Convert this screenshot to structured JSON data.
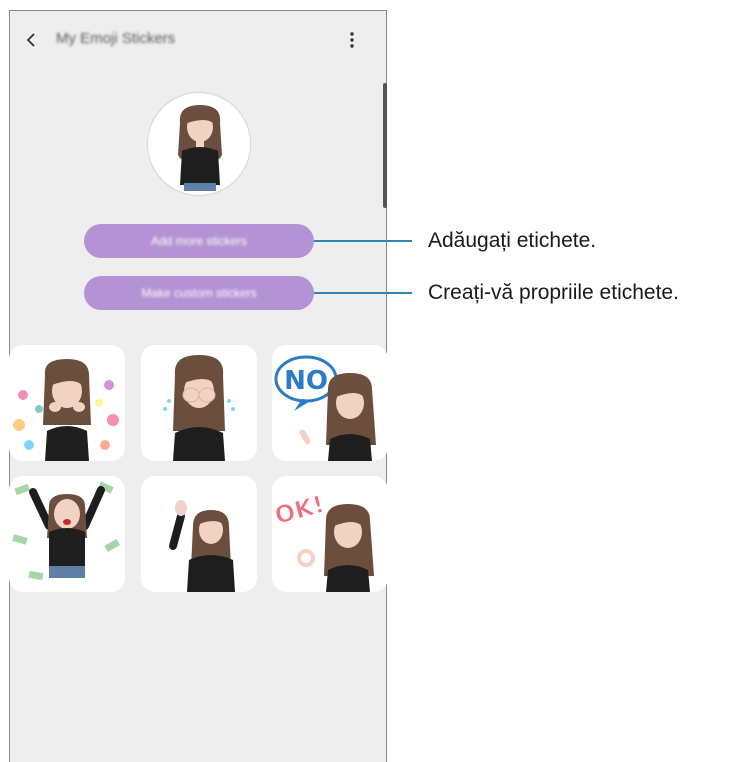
{
  "header": {
    "back_icon": "chevron-left-icon",
    "title": "My Emoji Stickers",
    "more_icon": "more-vertical-icon"
  },
  "profile": {
    "avatar": "emoji-avatar"
  },
  "buttons": {
    "add_more": "Add more stickers",
    "make_custom": "Make custom stickers"
  },
  "callouts": {
    "add_more": "Adăugați etichete.",
    "make_custom": "Creați-vă propriile etichete."
  },
  "stickers": [
    {
      "name": "hearts-sticker",
      "text": ""
    },
    {
      "name": "crying-sticker",
      "text": ""
    },
    {
      "name": "no-sticker",
      "text": "NO"
    },
    {
      "name": "money-sticker",
      "text": ""
    },
    {
      "name": "waving-sticker",
      "text": ""
    },
    {
      "name": "ok-sticker",
      "text": "OK!"
    }
  ],
  "colors": {
    "button": "#b493d4",
    "callout_line": "#2f86a8",
    "background": "#eeeeee",
    "hair": "#6b4e3d",
    "shirt": "#1e1e1e"
  }
}
